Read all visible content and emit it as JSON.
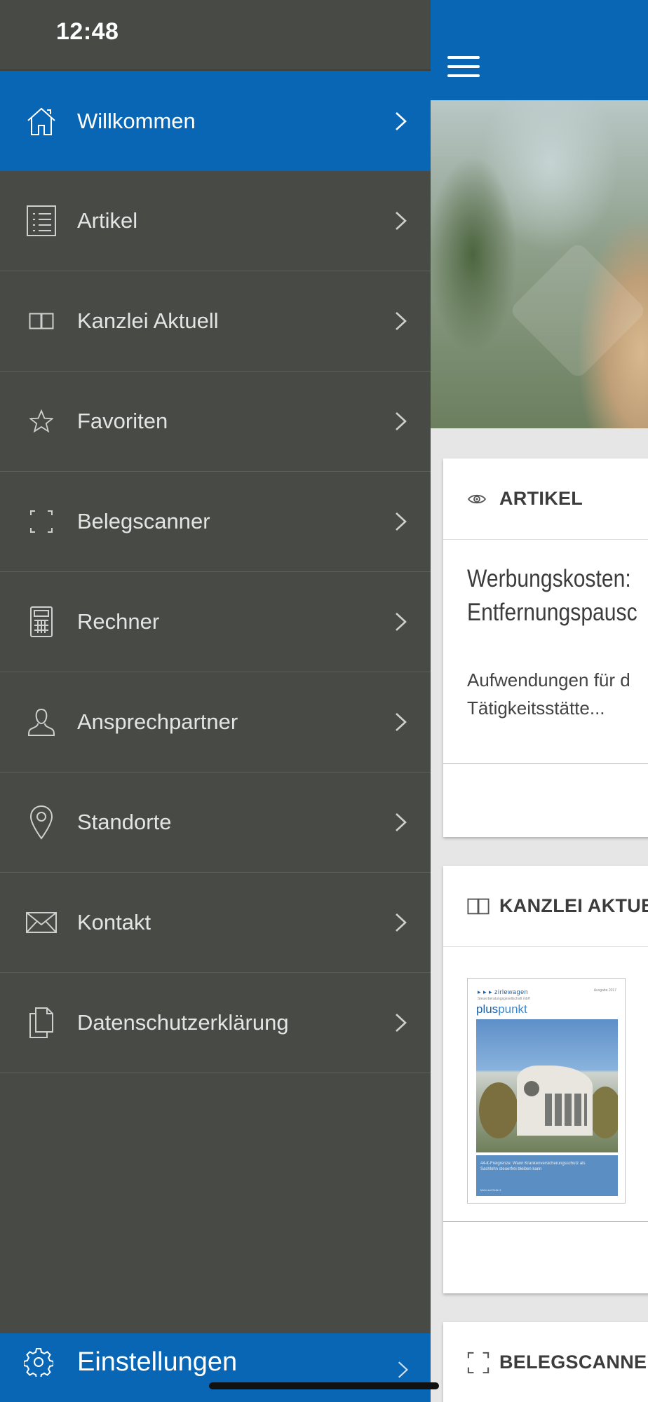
{
  "status_bar": {
    "time": "12:48"
  },
  "drawer": {
    "items": [
      {
        "id": "willkommen",
        "label": "Willkommen",
        "icon": "home-icon",
        "active": true
      },
      {
        "id": "artikel",
        "label": "Artikel",
        "icon": "list-icon",
        "active": false
      },
      {
        "id": "kanzlei-aktuell",
        "label": "Kanzlei Aktuell",
        "icon": "book-icon",
        "active": false
      },
      {
        "id": "favoriten",
        "label": "Favoriten",
        "icon": "star-icon",
        "active": false
      },
      {
        "id": "belegscanner",
        "label": "Belegscanner",
        "icon": "scan-frame-icon",
        "active": false
      },
      {
        "id": "rechner",
        "label": "Rechner",
        "icon": "calculator-icon",
        "active": false
      },
      {
        "id": "ansprechpartner",
        "label": "Ansprechpartner",
        "icon": "person-icon",
        "active": false
      },
      {
        "id": "standorte",
        "label": "Standorte",
        "icon": "map-pin-icon",
        "active": false
      },
      {
        "id": "kontakt",
        "label": "Kontakt",
        "icon": "envelope-icon",
        "active": false
      },
      {
        "id": "datenschutz",
        "label": "Datenschutzerklärung",
        "icon": "documents-icon",
        "active": false
      }
    ],
    "settings": {
      "label": "Einstellungen",
      "icon": "gear-icon"
    }
  },
  "main": {
    "cards": {
      "artikel": {
        "title": "ARTIKEL",
        "icon": "eye-icon",
        "headline": "Werbungskosten:\nEntfernungspausc",
        "teaser": "Aufwendungen für d\nTätigkeitsstätte..."
      },
      "kanzlei": {
        "title": "KANZLEI AKTUE",
        "icon": "book-icon",
        "cover": {
          "brand": "▸ ▸ ▸ zirlewagen",
          "brand_sub": "Steuerberatungsgesellschaft mbH",
          "issue": "Ausgabe 2017",
          "title_a": "plus",
          "title_b": "punkt",
          "band_text": "44-€-Freigrenze: Wann Krankenversicherungsschutz als\nSachlohn steuerfrei bleiben kann",
          "band_foot": "Mehr auf Seite 3"
        }
      },
      "beleg": {
        "title": "BELEGSCANNE",
        "icon": "scan-frame-icon"
      }
    }
  },
  "colors": {
    "brand_blue": "#0866b5",
    "drawer_bg": "#484a46",
    "divider": "#5d5f5b"
  }
}
